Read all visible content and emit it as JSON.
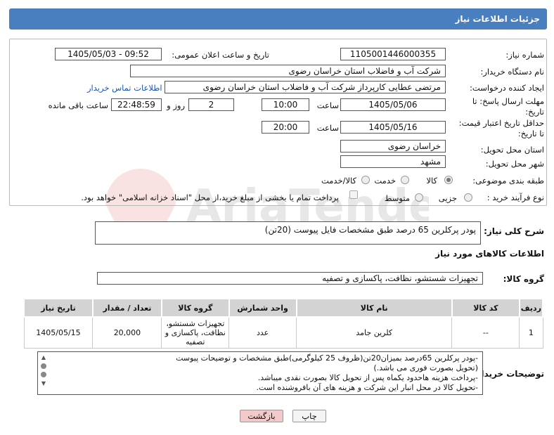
{
  "header": {
    "title": "جزئیات اطلاعات نیاز"
  },
  "form": {
    "need_number_label": "شماره نیاز:",
    "need_number": "1105001446000355",
    "announce_label": "تاریخ و ساعت اعلان عمومی:",
    "announce_value": "1405/05/03 - 09:52",
    "buyer_label": "نام دستگاه خریدار:",
    "buyer": "شرکت آب و فاضلاب استان خراسان رضوی",
    "creator_label": "ایجاد کننده درخواست:",
    "creator": "مرتضی عطایی کارپرداز شرکت آب و فاضلاب استان خراسان رضوی",
    "contact_link": "اطلاعات تماس خریدار",
    "reply_label_1": "مهلت ارسال پاسخ: تا",
    "reply_label_2": "تاریخ:",
    "reply_date": "1405/05/06",
    "time_label": "ساعت",
    "reply_time": "10:00",
    "days_value": "2",
    "days_label": "روز و",
    "remaining_time": "22:48:59",
    "remaining_label": "ساعت باقی مانده",
    "price_label_1": "حداقل تاریخ اعتبار قیمت:",
    "price_label_2": "تا تاریخ:",
    "price_date": "1405/05/16",
    "price_time": "20:00",
    "province_label": "استان محل تحویل:",
    "province": "خراسان رضوی",
    "city_label": "شهر محل تحویل:",
    "city": "مشهد",
    "category_label": "طبقه بندی موضوعی:",
    "category_options": [
      "کالا",
      "خدمت",
      "کالا/خدمت"
    ],
    "process_label": "نوع فرآیند خرید :",
    "process_options": [
      "جزیی",
      "متوسط"
    ],
    "payment_note": "پرداخت تمام یا بخشی از مبلغ خرید،از محل \"اسناد خزانه اسلامی\" خواهد بود."
  },
  "summary": {
    "label": "شرح کلی نیاز:",
    "text": "پودر پرکلرین 65 درصد طبق مشخصات فایل پیوست (20تن)"
  },
  "goods": {
    "section_title": "اطلاعات کالاهای مورد نیاز",
    "group_label": "گروه کالا:",
    "group_value": "تجهیزات شستشو، نظافت، پاکسازی و تصفیه",
    "columns": [
      "ردیف",
      "کد کالا",
      "نام کالا",
      "واحد شمارش",
      "گروه کالا",
      "تعداد / مقدار",
      "تاریخ نیاز"
    ],
    "rows": [
      {
        "row": "1",
        "code": "--",
        "name": "کلرین جامد",
        "unit": "عدد",
        "group": "تجهیزات شستشو، نظافت، پاکسازی و تصفیه",
        "qty": "20,000",
        "date": "1405/05/15"
      }
    ]
  },
  "buyer_notes": {
    "label": "توضیحات خریدار:",
    "lines": [
      "-پودر پرکلرین 65درصد بمیزان20تن(ظروف 25 کیلوگرمی)طبق مشخصات و توضیحات پیوست",
      "(تحویل بصورت فوری می باشد.)",
      "-پرداخت هزینه هاحدود یکماه پس از تحویل کالا بصورت نقدی میباشد.",
      "-تحویل کالا در محل انبار این شرکت و هزینه های آن بافروشنده است."
    ]
  },
  "buttons": {
    "print": "چاپ",
    "back": "بازگشت"
  },
  "watermark": {
    "text": "AriaTender.neT"
  },
  "colors": {
    "title_bar": "#4a7fbf",
    "back_button": "#f3c9c9",
    "link": "#1a56b8"
  }
}
